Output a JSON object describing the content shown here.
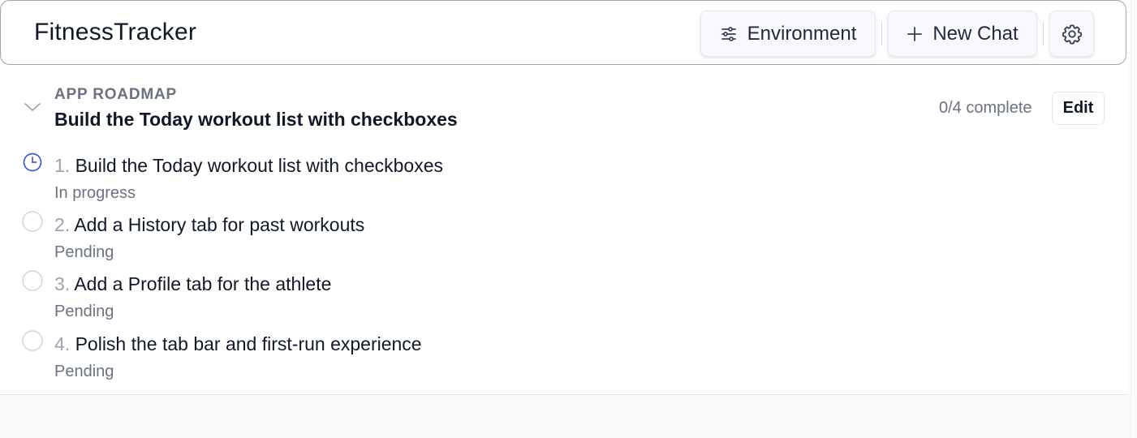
{
  "header": {
    "app_title": "FitnessTracker",
    "environment_label": "Environment",
    "new_chat_label": "New Chat"
  },
  "roadmap": {
    "section_label": "APP ROADMAP",
    "current_title": "Build the Today workout list with checkboxes",
    "progress": "0/4 complete",
    "edit_label": "Edit",
    "steps": [
      {
        "number": "1.",
        "title": "Build the Today workout list with checkboxes",
        "status": "In progress",
        "state": "in-progress"
      },
      {
        "number": "2.",
        "title": "Add a History tab for past workouts",
        "status": "Pending",
        "state": "pending"
      },
      {
        "number": "3.",
        "title": "Add a Profile tab for the athlete",
        "status": "Pending",
        "state": "pending"
      },
      {
        "number": "4.",
        "title": "Polish the tab bar and first-run experience",
        "status": "Pending",
        "state": "pending"
      }
    ]
  },
  "colors": {
    "accent_in_progress": "#3b5bdb",
    "pending_circle": "#d1d5db",
    "muted_text": "#6b7280"
  },
  "icons": {
    "environment": "sliders-icon",
    "new_chat": "plus-icon",
    "settings": "gear-icon",
    "collapse": "chevron-down-icon",
    "in_progress": "clock-icon",
    "pending": "circle-icon"
  }
}
